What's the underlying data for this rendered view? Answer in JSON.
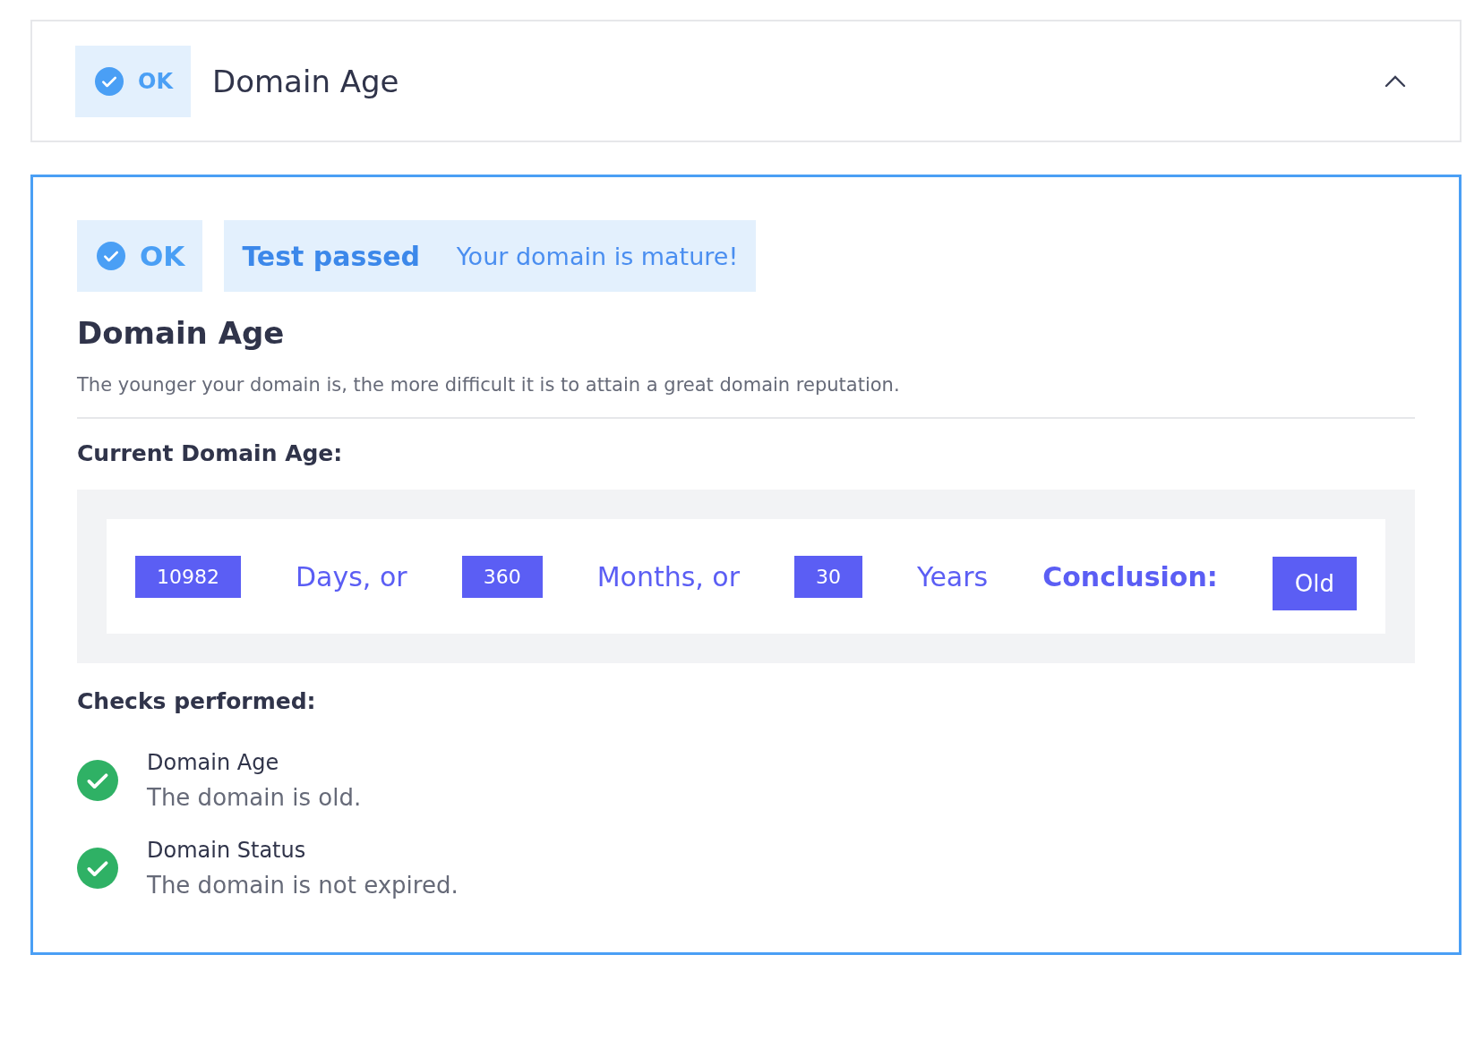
{
  "header": {
    "status": "OK",
    "title": "Domain Age",
    "expanded": true
  },
  "result": {
    "status": "OK",
    "verdict": "Test passed",
    "message": "Your domain is mature!"
  },
  "title": "Domain Age",
  "description": "The younger your domain is, the more difficult it is to attain a great domain reputation.",
  "age_heading": "Current Domain Age:",
  "age_items": [
    {
      "kind": "value",
      "text": "10982"
    },
    {
      "kind": "unit",
      "text": "Days, or"
    },
    {
      "kind": "value",
      "text": "360"
    },
    {
      "kind": "unit",
      "text": "Months, or"
    },
    {
      "kind": "value",
      "text": "30"
    },
    {
      "kind": "unit",
      "text": "Years"
    },
    {
      "kind": "label",
      "text": "Conclusion:"
    },
    {
      "kind": "result",
      "text": "Old"
    }
  ],
  "checks_heading": "Checks performed:",
  "checks": [
    {
      "name": "Domain Age",
      "detail": "The domain is old.",
      "passed": true
    },
    {
      "name": "Domain Status",
      "detail": "The domain is not expired.",
      "passed": true
    }
  ]
}
